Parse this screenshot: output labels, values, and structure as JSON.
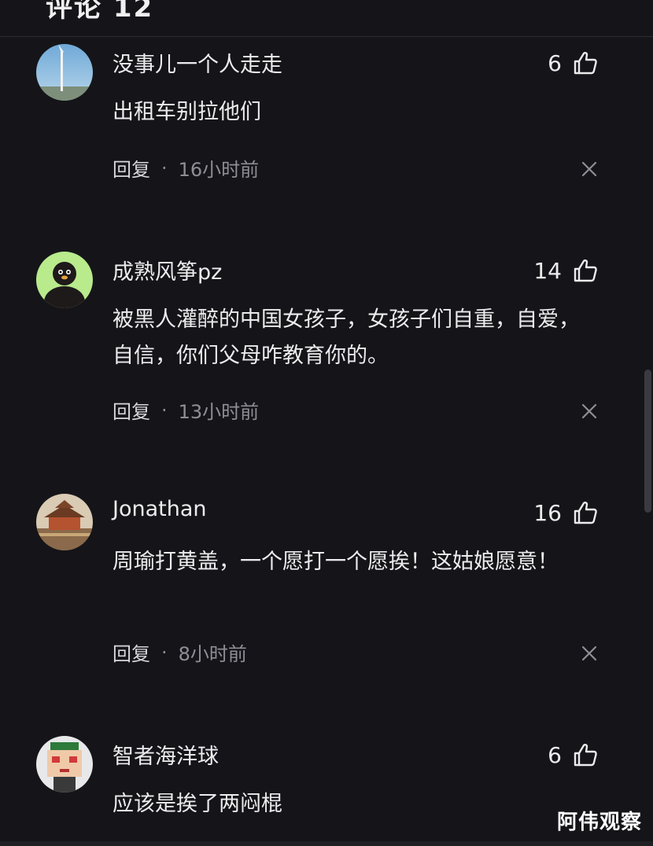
{
  "header": {
    "title": "评论 12"
  },
  "comments": [
    {
      "username": "没事儿一个人走走",
      "likes": "6",
      "text": "出租车别拉他们",
      "reply_label": "回复",
      "separator": "·",
      "time": "16小时前",
      "avatar": "windmill-avatar"
    },
    {
      "username": "成熟风筝pz",
      "likes": "14",
      "text": "被黑人灌醉的中国女孩子，女孩子们自重，自爱，自信，你们父母咋教育你的。",
      "reply_label": "回复",
      "separator": "·",
      "time": "13小时前",
      "avatar": "penguin-avatar"
    },
    {
      "username": "Jonathan",
      "likes": "16",
      "text": "周瑜打黄盖，一个愿打一个愿挨！这姑娘愿意！",
      "reply_label": "回复",
      "separator": "·",
      "time": "8小时前",
      "avatar": "palace-avatar"
    },
    {
      "username": "智者海洋球",
      "likes": "6",
      "text": "应该是挨了两闷棍",
      "avatar": "pixel-character-avatar"
    }
  ],
  "watermark": "阿伟观察",
  "icons": {
    "like": "thumbs-up-icon",
    "dismiss": "close-icon"
  },
  "colors": {
    "background": "#151519",
    "text": "#ececee",
    "muted": "#8e8e95"
  }
}
